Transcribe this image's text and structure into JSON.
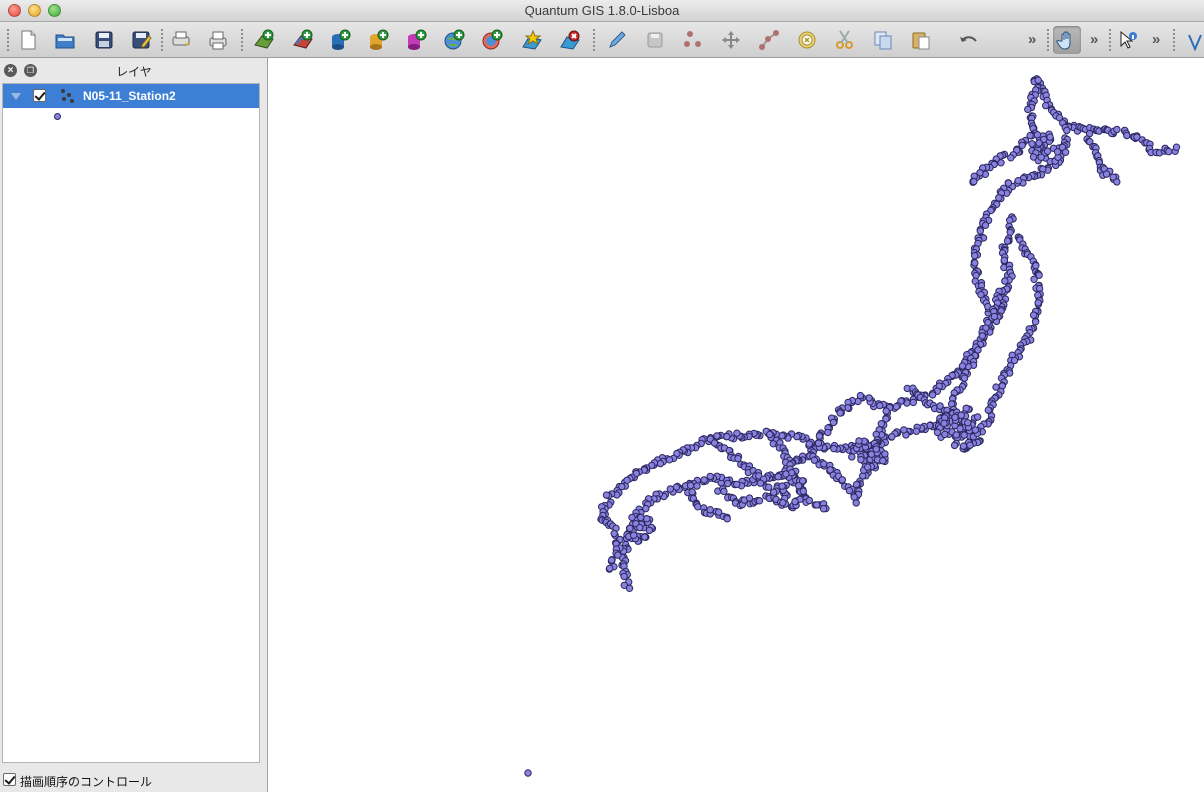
{
  "window": {
    "title": "Quantum GIS 1.8.0-Lisboa"
  },
  "toolbar": {
    "buttons": [
      {
        "name": "new-project",
        "icon": "new-document-icon"
      },
      {
        "name": "open-project",
        "icon": "open-folder-icon"
      },
      {
        "name": "save-project",
        "icon": "floppy-disk-icon"
      },
      {
        "name": "save-project-as",
        "icon": "save-as-icon"
      },
      {
        "name": "new-print-composer",
        "icon": "print-composer-icon"
      },
      {
        "name": "composer-manager",
        "icon": "printer-icon"
      },
      {
        "name": "add-vector-layer",
        "icon": "add-vector-layer-icon"
      },
      {
        "name": "add-raster-layer",
        "icon": "add-raster-layer-icon"
      },
      {
        "name": "add-postgis-layer",
        "icon": "add-postgis-layer-icon"
      },
      {
        "name": "add-spatialite-layer",
        "icon": "add-spatialite-layer-icon"
      },
      {
        "name": "add-mssql-layer",
        "icon": "add-mssql-layer-icon"
      },
      {
        "name": "add-wms-layer",
        "icon": "add-wms-layer-icon"
      },
      {
        "name": "add-wfs-layer",
        "icon": "add-wfs-layer-icon"
      },
      {
        "name": "new-shapefile-layer",
        "icon": "new-layer-star-icon"
      },
      {
        "name": "remove-layer",
        "icon": "remove-layer-icon"
      },
      {
        "name": "toggle-editing",
        "icon": "pencil-icon"
      },
      {
        "name": "save-edits",
        "icon": "save-edits-icon"
      },
      {
        "name": "add-feature",
        "icon": "add-points-icon"
      },
      {
        "name": "move-feature",
        "icon": "move-arrows-icon"
      },
      {
        "name": "node-tool",
        "icon": "node-tool-icon"
      },
      {
        "name": "delete-selected",
        "icon": "delete-selected-icon"
      },
      {
        "name": "cut-features",
        "icon": "scissors-icon"
      },
      {
        "name": "copy-features",
        "icon": "copy-icon"
      },
      {
        "name": "paste-features",
        "icon": "paste-icon"
      },
      {
        "name": "undo",
        "icon": "undo-arrow-icon"
      },
      {
        "name": "pan-map",
        "icon": "hand-pan-icon"
      },
      {
        "name": "identify-features",
        "icon": "identify-cursor-icon"
      }
    ],
    "overflow_chevron": "»"
  },
  "layers_panel": {
    "title": "レイヤ",
    "close_icon": "close-icon",
    "float_icon": "float-icon",
    "layers": [
      {
        "name": "N05-11_Station2",
        "visible": true,
        "selected": true
      }
    ],
    "render_order_label": "描画順序のコントロール",
    "render_order_checked": true
  },
  "map": {
    "point_fill": "#8a82df",
    "point_stroke": "#2c2860"
  }
}
